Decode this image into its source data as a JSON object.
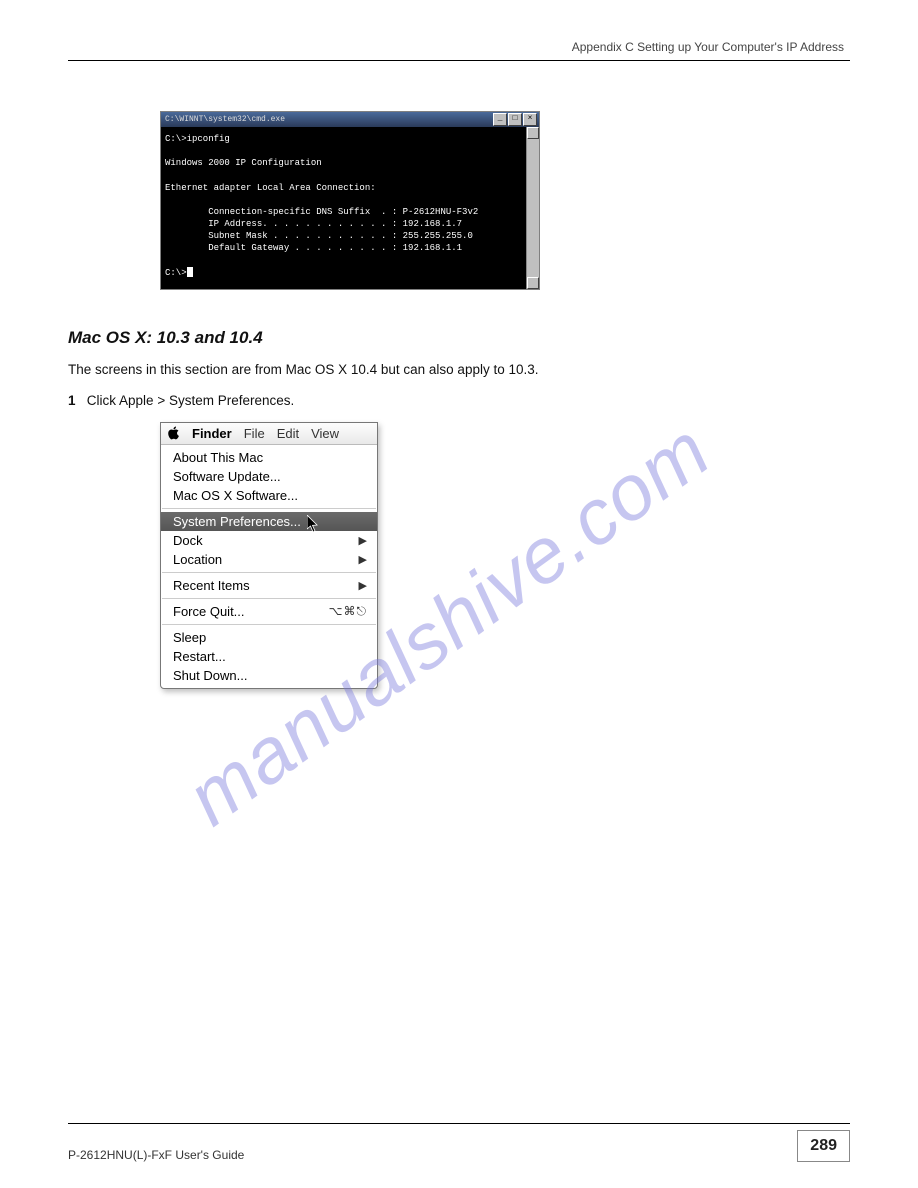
{
  "header": {
    "right_text": "Appendix C Setting up Your Computer's IP Address"
  },
  "cmd": {
    "title": "C:\\WINNT\\system32\\cmd.exe",
    "btn_min": "_",
    "btn_max": "□",
    "btn_close": "×",
    "body": "C:\\>ipconfig\n\nWindows 2000 IP Configuration\n\nEthernet adapter Local Area Connection:\n\n        Connection-specific DNS Suffix  . : P-2612HNU-F3v2\n        IP Address. . . . . . . . . . . . : 192.168.1.7\n        Subnet Mask . . . . . . . . . . . : 255.255.255.0\n        Default Gateway . . . . . . . . . : 192.168.1.1\n\nC:\\>"
  },
  "section": {
    "heading": "Mac OS X: 10.3 and 10.4",
    "intro": "The screens in this section are from Mac OS X 10.4 but can also apply to 10.3.",
    "step1_num": "1",
    "step1_rest": "Click Apple > System Preferences."
  },
  "mac": {
    "menubar": {
      "finder": "Finder",
      "file": "File",
      "edit": "Edit",
      "view": "View"
    },
    "items": {
      "about": "About This Mac",
      "softupd": "Software Update...",
      "osxsoft": "Mac OS X Software...",
      "sysprefs": "System Preferences...",
      "dock": "Dock",
      "location": "Location",
      "recent": "Recent Items",
      "forcequit": "Force Quit...",
      "forcequit_shortcut": "⌥⌘⎋",
      "sleep": "Sleep",
      "restart": "Restart...",
      "shutdown": "Shut Down..."
    }
  },
  "watermark": "manualshive.com",
  "footer": {
    "left": "P-2612HNU(L)-FxF User's Guide",
    "page": "289"
  }
}
